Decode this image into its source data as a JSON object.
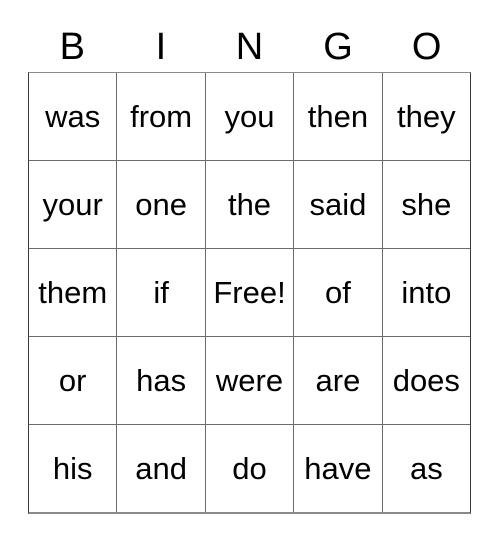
{
  "card": {
    "title": "BINGO",
    "headers": [
      "B",
      "I",
      "N",
      "G",
      "O"
    ],
    "free_space_label": "Free!",
    "text_color": "#000000",
    "background_color": "#ffffff",
    "grid_line_color": "#6b6b6b",
    "rows": [
      {
        "cells": [
          "was",
          "from",
          "you",
          "then",
          "they"
        ]
      },
      {
        "cells": [
          "your",
          "one",
          "the",
          "said",
          "she"
        ]
      },
      {
        "cells": [
          "them",
          "if",
          "Free!",
          "of",
          "into"
        ]
      },
      {
        "cells": [
          "or",
          "has",
          "were",
          "are",
          "does"
        ]
      },
      {
        "cells": [
          "his",
          "and",
          "do",
          "have",
          "as"
        ]
      }
    ]
  }
}
